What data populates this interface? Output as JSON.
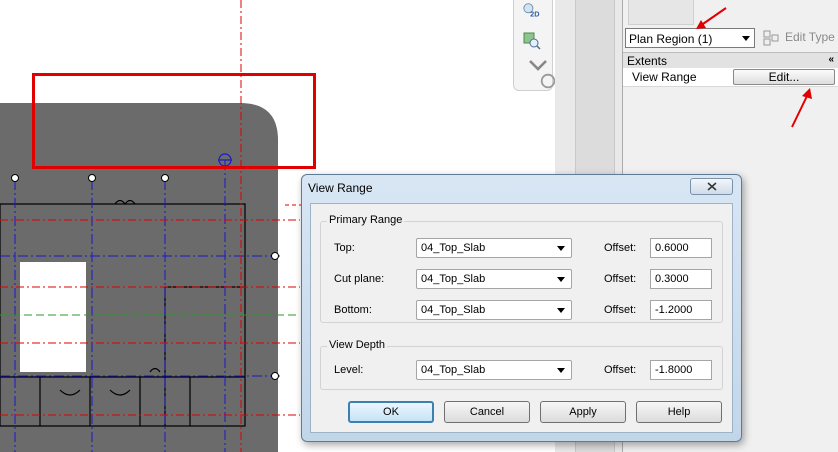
{
  "properties": {
    "type_selector_value": "Plan Region (1)",
    "edit_type_label": "Edit Type",
    "section_title": "Extents",
    "collapse_glyph": "«",
    "view_range_label": "View Range",
    "edit_button_label": "Edit..."
  },
  "dialog": {
    "title": "View Range",
    "primary_range": {
      "title": "Primary Range",
      "rows": [
        {
          "label": "Top:",
          "level": "04_Top_Slab",
          "offset_label": "Offset:",
          "offset": "0.6000"
        },
        {
          "label": "Cut plane:",
          "level": "04_Top_Slab",
          "offset_label": "Offset:",
          "offset": "0.3000"
        },
        {
          "label": "Bottom:",
          "level": "04_Top_Slab",
          "offset_label": "Offset:",
          "offset": "-1.2000"
        }
      ]
    },
    "view_depth": {
      "title": "View Depth",
      "label": "Level:",
      "level": "04_Top_Slab",
      "offset_label": "Offset:",
      "offset": "-1.8000"
    },
    "buttons": {
      "ok": "OK",
      "cancel": "Cancel",
      "apply": "Apply",
      "help": "Help"
    }
  },
  "colors": {
    "annotation_red": "#e00000",
    "gridline_red": "#e00000",
    "gridline_blue": "#1a1ac8",
    "plan_fill": "#6b6b6b",
    "dialog_accent": "#3c7fb1"
  },
  "icons": [
    "view-cube-2d-icon",
    "zoom-icon",
    "chevron-down-icon",
    "edit-type-icon",
    "close-icon",
    "red-arrow-icon"
  ]
}
